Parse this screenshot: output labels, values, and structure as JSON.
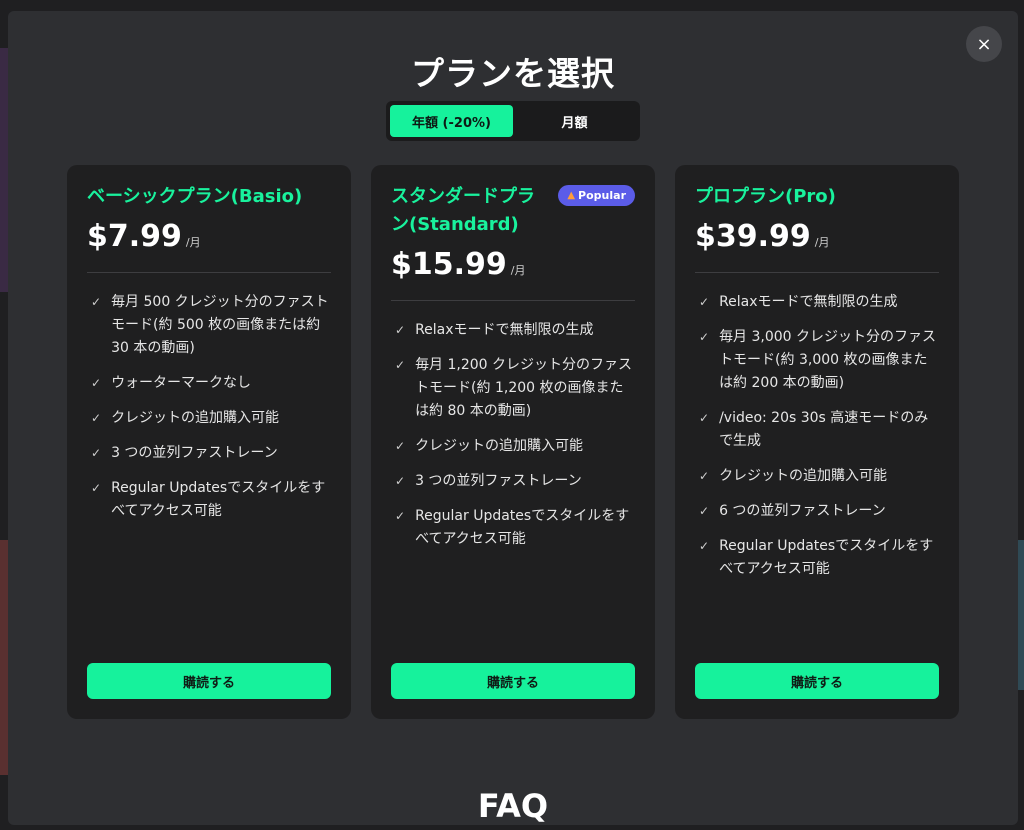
{
  "modal": {
    "title": "プランを選択",
    "close_label": "×",
    "billing_toggle": [
      {
        "label": "年額 (-20%)",
        "active": true
      },
      {
        "label": "月額",
        "active": false
      }
    ],
    "footer_heading": "FAQ"
  },
  "plans": [
    {
      "name": "ベーシックプラン(Basio)",
      "price": "$7.99",
      "period": "/月",
      "features": [
        "毎月 500 クレジット分のファストモード(約 500 枚の画像または約 30 本の動画)",
        "ウォーターマークなし",
        "クレジットの追加購入可能",
        "3 つの並列ファストレーン",
        "Regular Updatesでスタイルをすべてアクセス可能"
      ],
      "cta": "購読する"
    },
    {
      "name": "スタンダードプラン(Standard)",
      "badge": "Popular",
      "price": "$15.99",
      "period": "/月",
      "features": [
        "Relaxモードで無制限の生成",
        "毎月 1,200 クレジット分のファストモード(約 1,200 枚の画像または約 80 本の動画)",
        "クレジットの追加購入可能",
        "3 つの並列ファストレーン",
        "Regular Updatesでスタイルをすべてアクセス可能"
      ],
      "cta": "購読する"
    },
    {
      "name": "プロプラン(Pro)",
      "price": "$39.99",
      "period": "/月",
      "features": [
        "Relaxモードで無制限の生成",
        "毎月 3,000 クレジット分のファストモード(約 3,000 枚の画像または約 200 本の動画)",
        "/video: 20s 30s 高速モードのみで生成",
        "クレジットの追加購入可能",
        "6 つの並列ファストレーン",
        "Regular Updatesでスタイルをすべてアクセス可能"
      ],
      "cta": "購読する"
    }
  ],
  "icons": {
    "check": "check-icon",
    "flame": "flame-icon",
    "close": "close-icon"
  },
  "colors": {
    "accent": "#16f29c",
    "badge": "#5b5ce8",
    "card_bg": "#1f1f20",
    "modal_bg": "#2e2f32"
  }
}
